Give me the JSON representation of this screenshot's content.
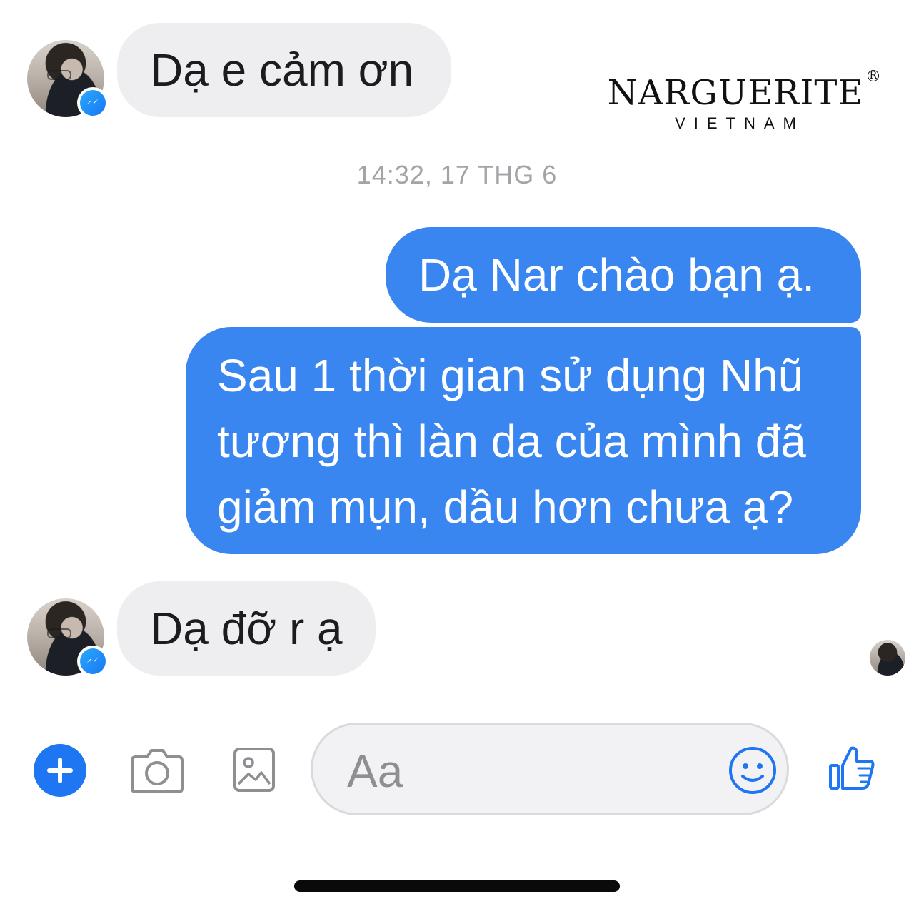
{
  "brand": {
    "name": "NARGUERITE",
    "sub": "VIETNAM",
    "reg": "R"
  },
  "timestamp": "14:32, 17 THG 6",
  "messages": [
    {
      "from": "contact",
      "text": "Dạ e cảm ơn"
    },
    {
      "from": "me",
      "text": "Dạ Nar chào bạn ạ."
    },
    {
      "from": "me",
      "lines": [
        "Sau 1 thời gian sử dụng Nhũ",
        "tương thì làn da của mình đã",
        "giảm mụn, dầu hơn chưa ạ?"
      ]
    },
    {
      "from": "contact",
      "text": "Dạ đỡ r ạ"
    }
  ],
  "composer": {
    "placeholder": "Aa"
  },
  "toolbar_icons": [
    "plus-icon",
    "camera-icon",
    "image-icon",
    "emoji-icon",
    "thumbs-up-icon"
  ],
  "colors": {
    "accent": "#3a86f0",
    "incoming_bubble": "#eeeef0",
    "timestamp": "#a3a3a8",
    "messenger_badge": "#1877f2"
  }
}
